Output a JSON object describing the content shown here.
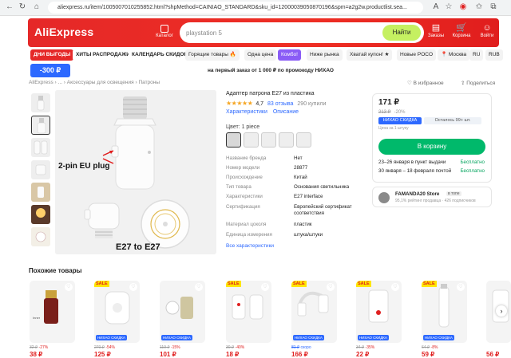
{
  "browser": {
    "url": "aliexpress.ru/item/1005007010255852.html?shpMethod=CAINIAO_STANDARD&sku_id=12000039050870196&spm=a2g2w.productlist.sea..."
  },
  "header": {
    "logo": "AliExpress",
    "catalog_label": "Каталог",
    "search_value": "playstation 5",
    "search_button": "Найти",
    "icons": [
      {
        "name": "orders",
        "label": "Заказы",
        "glyph": "▤"
      },
      {
        "name": "cart",
        "label": "Корзина",
        "glyph": "🛒"
      },
      {
        "name": "login",
        "label": "Войти",
        "glyph": "☺"
      }
    ]
  },
  "nav": {
    "chips": [
      "ДНИ ВЫГОДЫ",
      "ХИТЫ РАСПРОДАЖИ",
      "КАЛЕНДАРЬ СКИДОК",
      "Горящие товары 🔥",
      "Одна цена",
      "Комбо!",
      "Ниже рынка",
      "Хватай купон! ★",
      "Новые POCO",
      "📍 Москва",
      "RU",
      "RUB"
    ]
  },
  "promo": {
    "badge": "-300 ₽",
    "text": "на первый заказ от 1 000 ₽ по промокоду НИХАО"
  },
  "breadcrumb": {
    "items": [
      "AliExpress",
      "›",
      "...",
      "›",
      "Аксессуары для освещения",
      "›",
      "Патроны"
    ],
    "favorites": "♡ В избранное",
    "share": "⇪ Поделиться"
  },
  "gallery": {
    "overlay_plug": "2-pin EU plug",
    "overlay_e27": "E27 to E27"
  },
  "product": {
    "title": "Адаптер патрона E27 из пластика",
    "stars": "★★★★★",
    "rating": "4,7",
    "reviews": "83 отзыва",
    "bought": "290 купили",
    "link_specs": "Характеристики",
    "link_desc": "Описание",
    "color_label": "Цвет: 1 piece",
    "specs": [
      {
        "k": "Название бренда",
        "v": "Нет"
      },
      {
        "k": "Номер модели",
        "v": "28877"
      },
      {
        "k": "Происхождение",
        "v": "Китай"
      },
      {
        "k": "Тип товара",
        "v": "Основания светильника"
      },
      {
        "k": "Характеристики",
        "v": "E27 interface"
      },
      {
        "k": "Сертификация",
        "v": "Европейский сертификат соответствия"
      },
      {
        "k": "Материал цоколя",
        "v": "пластик"
      },
      {
        "k": "Единица измерения",
        "v": "штука/штуки"
      }
    ],
    "all_specs": "Все характеристики"
  },
  "buy": {
    "price": "171 ₽",
    "old_price": "213 ₽",
    "discount": "-20%",
    "choice": "НИХАО СКИДКА",
    "stock": "Осталось 99+ шт.",
    "per_unit": "Цена за 1 штуку",
    "cart_button": "В корзину",
    "delivery": [
      {
        "date": "23–26 января в пункт выдачи",
        "fee": "Бесплатно"
      },
      {
        "date": "30 января – 18 февраля почтой",
        "fee": "Бесплатно"
      }
    ]
  },
  "store": {
    "name": "FAMANDA20 Store",
    "badge": "в топе",
    "sub": "95,1% рейтинг продавца · 426 подписчиков"
  },
  "similar": {
    "title": "Похожие товары",
    "cards": [
      {
        "sale": "",
        "choice": "",
        "old": "32 ₽",
        "disc": "-27%",
        "price": "38 ₽"
      },
      {
        "sale": "SALE",
        "choice": "НИХАО СКИДКА",
        "old": "270 ₽",
        "disc": "-54%",
        "price": "125 ₽"
      },
      {
        "sale": "",
        "choice": "НИХАО СКИДКА",
        "old": "119 ₽",
        "disc": "-15%",
        "price": "101 ₽"
      },
      {
        "sale": "SALE",
        "choice": "",
        "old": "30 ₽",
        "disc": "-40%",
        "price": "18 ₽"
      },
      {
        "sale": "SALE",
        "choice": "НИХАО СКИДКА",
        "old": "81 ₽",
        "disc": "скоро",
        "price": "166 ₽"
      },
      {
        "sale": "SALE",
        "choice": "НИХАО СКИДКА",
        "old": "34 ₽",
        "disc": "-35%",
        "price": "22 ₽"
      },
      {
        "sale": "SALE",
        "choice": "НИХАО СКИДКА",
        "old": "64 ₽",
        "disc": "-8%",
        "price": "59 ₽"
      },
      {
        "sale": "",
        "choice": "",
        "old": "",
        "disc": "",
        "price": "56 ₽"
      }
    ]
  }
}
